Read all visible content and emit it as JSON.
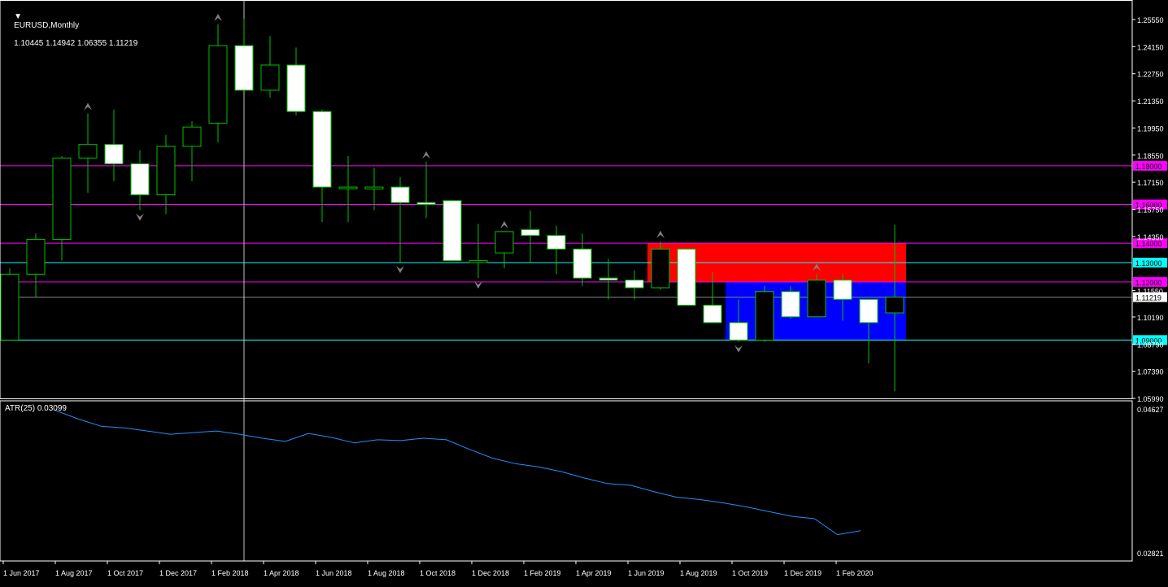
{
  "header": {
    "symbol": "EURUSD,Monthly",
    "ohlc": "1.10445 1.14942 1.06355 1.11219"
  },
  "indicator": {
    "label": "ATR(25) 0.03099",
    "axis_labels": [
      "0.04627",
      "0.02821"
    ],
    "range": [
      0.02821,
      0.04627
    ]
  },
  "colors": {
    "background": "#000000",
    "grid_border": "#ffffff",
    "bull_candle_outline": "#00c000",
    "bear_candle_body": "#ffffff",
    "level_magenta": "#ff00ff",
    "level_cyan": "#00ffff",
    "zone_red": "#ff0000",
    "zone_blue": "#0000ff",
    "atr_line": "#1e90ff",
    "fractal_arrow": "#808080"
  },
  "chart_data": [
    {
      "type": "candlestick",
      "symbol": "EURUSD",
      "timeframe": "Monthly",
      "price_axis_labels": [
        "1.25550",
        "1.24150",
        "1.22750",
        "1.21350",
        "1.19950",
        "1.18550",
        "1.17150",
        "1.15750",
        "1.14350",
        "1.11550",
        "1.10190",
        "1.08790",
        "1.07390",
        "1.05990"
      ],
      "price_range": [
        1.0599,
        1.2555
      ],
      "current_price": "1.11219",
      "x_labels": [
        "1 Jun 2017",
        "1 Aug 2017",
        "1 Oct 2017",
        "1 Dec 2017",
        "1 Feb 2018",
        "1 Apr 2018",
        "1 Jun 2018",
        "1 Aug 2018",
        "1 Oct 2018",
        "1 Dec 2018",
        "1 Feb 2019",
        "1 Apr 2019",
        "1 Jun 2019",
        "1 Aug 2019",
        "1 Oct 2019",
        "1 Dec 2019",
        "1 Feb 2020"
      ],
      "candles": [
        {
          "date": "2017-05",
          "o": 1.09,
          "h": 1.127,
          "l": 1.111,
          "c": 1.124
        },
        {
          "date": "2017-06",
          "o": 1.124,
          "h": 1.145,
          "l": 1.112,
          "c": 1.142
        },
        {
          "date": "2017-07",
          "o": 1.142,
          "h": 1.185,
          "l": 1.131,
          "c": 1.184
        },
        {
          "date": "2017-08",
          "o": 1.184,
          "h": 1.207,
          "l": 1.166,
          "c": 1.191
        },
        {
          "date": "2017-09",
          "o": 1.191,
          "h": 1.209,
          "l": 1.172,
          "c": 1.181
        },
        {
          "date": "2017-10",
          "o": 1.181,
          "h": 1.188,
          "l": 1.157,
          "c": 1.165
        },
        {
          "date": "2017-11",
          "o": 1.165,
          "h": 1.196,
          "l": 1.155,
          "c": 1.19
        },
        {
          "date": "2017-12",
          "o": 1.19,
          "h": 1.203,
          "l": 1.172,
          "c": 1.2
        },
        {
          "date": "2018-01",
          "o": 1.202,
          "h": 1.253,
          "l": 1.192,
          "c": 1.242
        },
        {
          "date": "2018-02",
          "o": 1.242,
          "h": 1.256,
          "l": 1.22,
          "c": 1.219
        },
        {
          "date": "2018-03",
          "o": 1.219,
          "h": 1.247,
          "l": 1.215,
          "c": 1.232
        },
        {
          "date": "2018-04",
          "o": 1.232,
          "h": 1.241,
          "l": 1.206,
          "c": 1.208
        },
        {
          "date": "2018-05",
          "o": 1.208,
          "h": 1.209,
          "l": 1.151,
          "c": 1.169
        },
        {
          "date": "2018-06",
          "o": 1.169,
          "h": 1.185,
          "l": 1.151,
          "c": 1.169
        },
        {
          "date": "2018-07",
          "o": 1.168,
          "h": 1.179,
          "l": 1.157,
          "c": 1.169
        },
        {
          "date": "2018-08",
          "o": 1.169,
          "h": 1.174,
          "l": 1.13,
          "c": 1.161
        },
        {
          "date": "2018-09",
          "o": 1.161,
          "h": 1.182,
          "l": 1.153,
          "c": 1.16
        },
        {
          "date": "2018-10",
          "o": 1.162,
          "h": 1.162,
          "l": 1.131,
          "c": 1.131
        },
        {
          "date": "2018-11",
          "o": 1.13,
          "h": 1.15,
          "l": 1.122,
          "c": 1.131
        },
        {
          "date": "2018-12",
          "o": 1.135,
          "h": 1.146,
          "l": 1.127,
          "c": 1.146
        },
        {
          "date": "2019-01",
          "o": 1.147,
          "h": 1.157,
          "l": 1.13,
          "c": 1.144
        },
        {
          "date": "2019-02",
          "o": 1.144,
          "h": 1.149,
          "l": 1.124,
          "c": 1.137
        },
        {
          "date": "2019-03",
          "o": 1.137,
          "h": 1.145,
          "l": 1.118,
          "c": 1.122
        },
        {
          "date": "2019-04",
          "o": 1.122,
          "h": 1.132,
          "l": 1.111,
          "c": 1.121
        },
        {
          "date": "2019-05",
          "o": 1.121,
          "h": 1.126,
          "l": 1.111,
          "c": 1.117
        },
        {
          "date": "2019-06",
          "o": 1.117,
          "h": 1.141,
          "l": 1.116,
          "c": 1.137
        },
        {
          "date": "2019-07",
          "o": 1.137,
          "h": 1.128,
          "l": 1.11,
          "c": 1.108
        },
        {
          "date": "2019-08",
          "o": 1.108,
          "h": 1.125,
          "l": 1.103,
          "c": 1.099
        },
        {
          "date": "2019-09",
          "o": 1.099,
          "h": 1.111,
          "l": 1.089,
          "c": 1.09
        },
        {
          "date": "2019-10",
          "o": 1.09,
          "h": 1.118,
          "l": 1.089,
          "c": 1.115
        },
        {
          "date": "2019-11",
          "o": 1.115,
          "h": 1.118,
          "l": 1.101,
          "c": 1.102
        },
        {
          "date": "2019-12",
          "o": 1.102,
          "h": 1.124,
          "l": 1.102,
          "c": 1.121
        },
        {
          "date": "2020-01",
          "o": 1.121,
          "h": 1.124,
          "l": 1.1,
          "c": 1.111
        },
        {
          "date": "2020-02",
          "o": 1.111,
          "h": 1.111,
          "l": 1.078,
          "c": 1.099
        },
        {
          "date": "2020-03",
          "o": 1.104,
          "h": 1.1494,
          "l": 1.0636,
          "c": 1.1122
        }
      ],
      "horizontal_levels": [
        {
          "price": 1.18,
          "label": "1.18000",
          "color": "#ff00ff"
        },
        {
          "price": 1.16,
          "label": "1.16000",
          "color": "#ff00ff"
        },
        {
          "price": 1.14,
          "label": "1.14000",
          "color": "#ff00ff"
        },
        {
          "price": 1.13,
          "label": "1.13000",
          "color": "#00ffff"
        },
        {
          "price": 1.12,
          "label": "1.12000",
          "color": "#ff00ff"
        },
        {
          "price": 1.09,
          "label": "1.09000",
          "color": "#00ffff"
        }
      ],
      "zones": [
        {
          "from": "2019-06",
          "to": "2020-03",
          "top": 1.14,
          "bottom": 1.12,
          "color": "#ff0000"
        },
        {
          "from": "2019-09",
          "to": "2020-03",
          "top": 1.12,
          "bottom": 1.09,
          "color": "#0000ff"
        }
      ],
      "fractals_up": [
        "2017-08",
        "2018-01",
        "2018-09",
        "2018-12",
        "2019-06",
        "2019-12"
      ],
      "fractals_down": [
        "2017-10",
        "2018-08",
        "2018-11",
        "2019-09"
      ],
      "crosshair_date": "2018-02"
    },
    {
      "type": "line",
      "name": "ATR(25)",
      "ylim": [
        0.02821,
        0.04627
      ],
      "x": [
        "2017-08",
        "2017-09",
        "2017-10",
        "2017-11",
        "2017-12",
        "2018-01",
        "2018-02",
        "2018-03",
        "2018-04",
        "2018-05",
        "2018-06",
        "2018-07",
        "2018-08",
        "2018-09",
        "2018-10",
        "2018-11",
        "2018-12",
        "2019-01",
        "2019-02",
        "2019-03",
        "2019-04",
        "2019-05",
        "2019-06",
        "2019-07",
        "2019-08",
        "2019-09",
        "2019-10",
        "2019-11",
        "2019-12",
        "2020-01",
        "2020-02",
        "2020-03"
      ],
      "values": [
        0.0461,
        0.045,
        0.0441,
        0.0439,
        0.0435,
        0.0431,
        0.0433,
        0.0435,
        0.0431,
        0.0426,
        0.0422,
        0.0432,
        0.0427,
        0.042,
        0.0424,
        0.0423,
        0.0426,
        0.0424,
        0.0412,
        0.0401,
        0.0394,
        0.039,
        0.0384,
        0.0376,
        0.0369,
        0.0367,
        0.0359,
        0.0352,
        0.0349,
        0.0345,
        0.034,
        0.0334,
        0.0328,
        0.0325,
        0.0305,
        0.031
      ]
    }
  ]
}
